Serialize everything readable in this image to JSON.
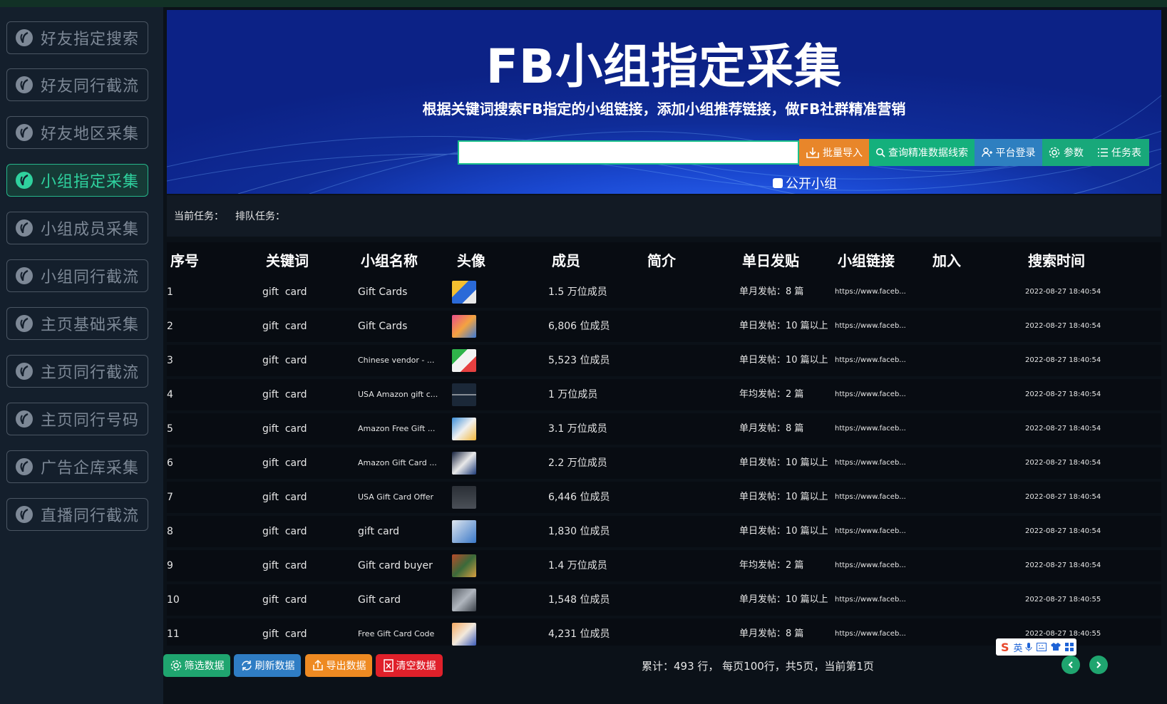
{
  "sidebar": {
    "items": [
      {
        "label": "好友指定搜索",
        "active": false
      },
      {
        "label": "好友同行截流",
        "active": false
      },
      {
        "label": "好友地区采集",
        "active": false
      },
      {
        "label": "小组指定采集",
        "active": true
      },
      {
        "label": "小组成员采集",
        "active": false
      },
      {
        "label": "小组同行截流",
        "active": false
      },
      {
        "label": "主页基础采集",
        "active": false
      },
      {
        "label": "主页同行截流",
        "active": false
      },
      {
        "label": "主页同行号码",
        "active": false
      },
      {
        "label": "广告企库采集",
        "active": false
      },
      {
        "label": "直播同行截流",
        "active": false
      }
    ],
    "icon": "leaf-icon",
    "colors": {
      "active": "#2fd19e",
      "inactive": "#7d8896"
    }
  },
  "hero": {
    "title": "FB小组指定采集",
    "subtitle": "根据关键词搜索FB指定的小组链接，添加小组推荐链接，做FB社群精准营销",
    "search_value": "",
    "buttons": {
      "import": "批量导入",
      "query": "查询精准数据线索",
      "login": "平台登录",
      "params": "参数",
      "tasks": "任务表"
    },
    "public_group_label": "公开小组",
    "public_group_checked": false
  },
  "tasks": {
    "current_label": "当前任务：",
    "queue_label": "排队任务："
  },
  "table": {
    "headers": [
      "序号",
      "关键词",
      "小组名称",
      "头像",
      "成员",
      "简介",
      "单日发贴",
      "小组链接",
      "加入",
      "搜索时间"
    ],
    "rows": [
      {
        "no": "1",
        "keyword": "gift  card",
        "name": "Gift Cards",
        "members": "1.5 万位成员",
        "intro": "",
        "daily": "单月发帖：8 篇",
        "link": "https://www.faceb...",
        "join": "",
        "time": "2022-08-27 18:40:54"
      },
      {
        "no": "2",
        "keyword": "gift  card",
        "name": "Gift Cards",
        "members": "6,806 位成员",
        "intro": "",
        "daily": "单日发帖：10 篇以上",
        "link": "https://www.faceb...",
        "join": "",
        "time": "2022-08-27 18:40:54"
      },
      {
        "no": "3",
        "keyword": "gift  card",
        "name": "Chinese vendor - ...",
        "members": "5,523 位成员",
        "intro": "",
        "daily": "单日发帖：10 篇以上",
        "link": "https://www.faceb...",
        "join": "",
        "time": "2022-08-27 18:40:54"
      },
      {
        "no": "4",
        "keyword": "gift  card",
        "name": "USA Amazon gift c...",
        "members": "1 万位成员",
        "intro": "",
        "daily": "年均发帖：2 篇",
        "link": "https://www.faceb...",
        "join": "",
        "time": "2022-08-27 18:40:54"
      },
      {
        "no": "5",
        "keyword": "gift  card",
        "name": "Amazon Free Gift ...",
        "members": "3.1 万位成员",
        "intro": "",
        "daily": "单月发帖：8 篇",
        "link": "https://www.faceb...",
        "join": "",
        "time": "2022-08-27 18:40:54"
      },
      {
        "no": "6",
        "keyword": "gift  card",
        "name": "Amazon Gift Card ...",
        "members": "2.2 万位成员",
        "intro": "",
        "daily": "单日发帖：10 篇以上",
        "link": "https://www.faceb...",
        "join": "",
        "time": "2022-08-27 18:40:54"
      },
      {
        "no": "7",
        "keyword": "gift  card",
        "name": "USA Gift Card Offer",
        "members": "6,446 位成员",
        "intro": "",
        "daily": "单日发帖：10 篇以上",
        "link": "https://www.faceb...",
        "join": "",
        "time": "2022-08-27 18:40:54"
      },
      {
        "no": "8",
        "keyword": "gift  card",
        "name": "gift card",
        "members": "1,830 位成员",
        "intro": "",
        "daily": "单日发帖：10 篇以上",
        "link": "https://www.faceb...",
        "join": "",
        "time": "2022-08-27 18:40:54"
      },
      {
        "no": "9",
        "keyword": "gift  card",
        "name": "Gift card buyer",
        "members": "1.4 万位成员",
        "intro": "",
        "daily": "年均发帖：2 篇",
        "link": "https://www.faceb...",
        "join": "",
        "time": "2022-08-27 18:40:54"
      },
      {
        "no": "10",
        "keyword": "gift  card",
        "name": "Gift card",
        "members": "1,548 位成员",
        "intro": "",
        "daily": "单月发帖：10 篇以上",
        "link": "https://www.faceb...",
        "join": "",
        "time": "2022-08-27 18:40:55"
      },
      {
        "no": "11",
        "keyword": "gift  card",
        "name": "Free Gift Card Code",
        "members": "4,231 位成员",
        "intro": "",
        "daily": "单月发帖：8 篇",
        "link": "https://www.faceb...",
        "join": "",
        "time": "2022-08-27 18:40:55"
      }
    ]
  },
  "footer": {
    "buttons": {
      "filter": "筛选数据",
      "refresh": "刷新数据",
      "export": "导出数据",
      "clear": "清空数据"
    },
    "stats": "累计：493 行，  每页100行，共5页，当前第1页",
    "ime": {
      "logo": "S",
      "lang": "英"
    }
  },
  "colors": {
    "import": "#e8862a",
    "query": "#14b07c",
    "login": "#2e7fc0",
    "params": "#18a87a",
    "tasks": "#18a87a",
    "filter": "#1fa56f",
    "refresh": "#2f7dc4",
    "export": "#ee8a22",
    "clear": "#e0202a"
  }
}
